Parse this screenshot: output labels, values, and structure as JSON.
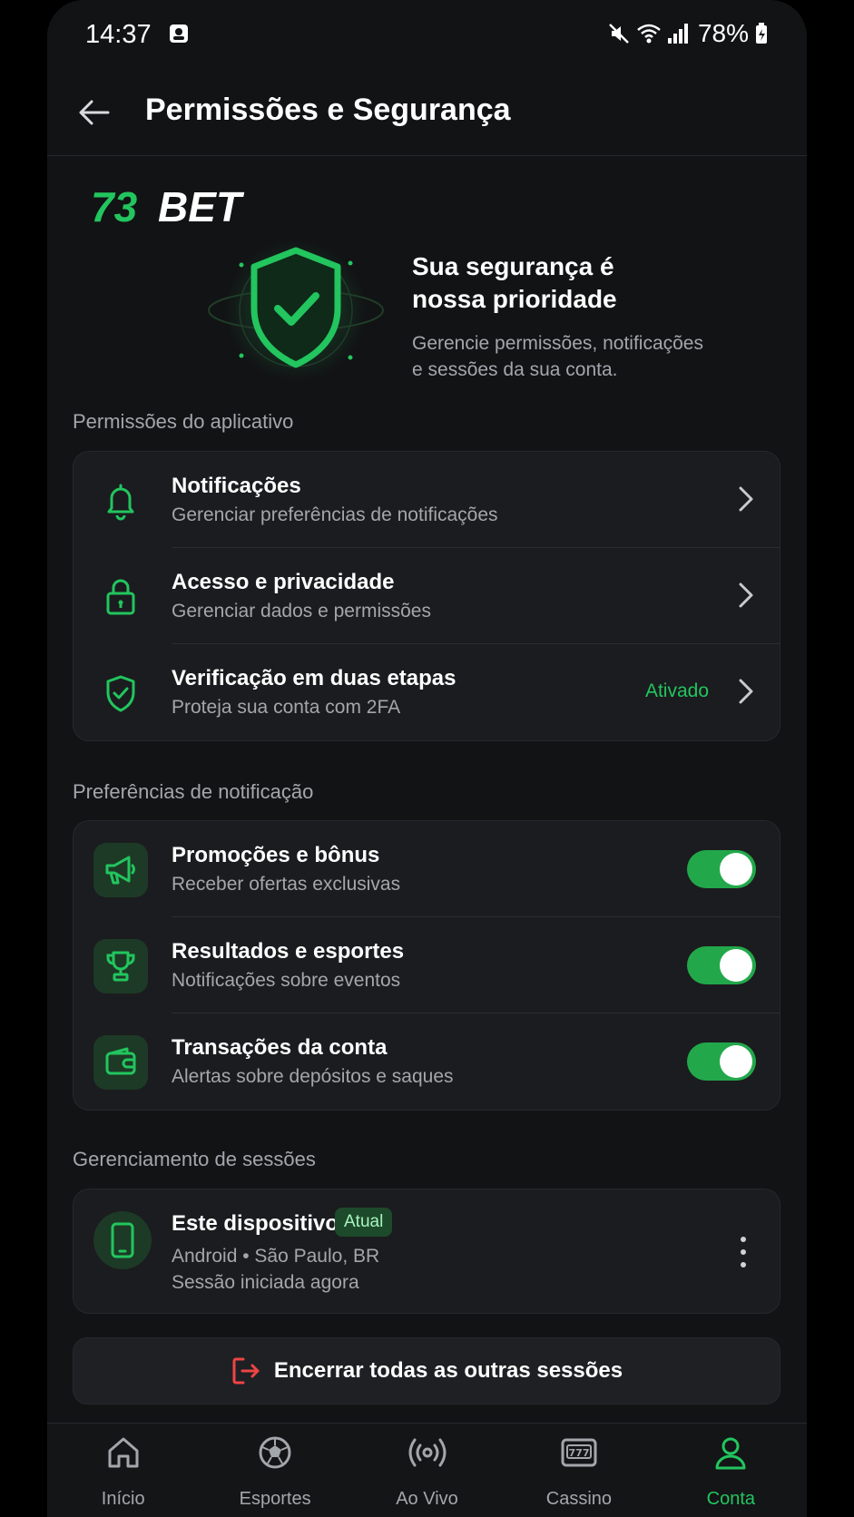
{
  "status_bar": {
    "time": "14:37",
    "battery": "78%"
  },
  "app_bar": {
    "title": "Permissões e Segurança"
  },
  "brand": {
    "logo_number": "73",
    "logo_word": "BET",
    "accent": "#22c55e"
  },
  "hero": {
    "title_line1": "Sua segurança é",
    "title_line2": "nossa prioridade",
    "subtitle_line1": "Gerencie permissões, notificações",
    "subtitle_line2": "e sessões da sua conta."
  },
  "app_permissions": {
    "section_title": "Permissões do aplicativo",
    "items": [
      {
        "icon": "bell-icon",
        "title": "Notificações",
        "subtitle": "Gerenciar preferências de notificações",
        "status": ""
      },
      {
        "icon": "lock-icon",
        "title": "Acesso e privacidade",
        "subtitle": "Gerenciar dados e permissões",
        "status": ""
      },
      {
        "icon": "shield-check-icon",
        "title": "Verificação em duas etapas",
        "subtitle": "Proteja sua conta com 2FA",
        "status": "Ativado"
      }
    ]
  },
  "notification_prefs": {
    "section_title": "Preferências de notificação",
    "items": [
      {
        "icon": "megaphone-icon",
        "title": "Promoções e bônus",
        "subtitle": "Receber ofertas exclusivas",
        "enabled": true
      },
      {
        "icon": "trophy-icon",
        "title": "Resultados e esportes",
        "subtitle": "Notificações sobre eventos",
        "enabled": true
      },
      {
        "icon": "wallet-icon",
        "title": "Transações da conta",
        "subtitle": "Alertas sobre depósitos e saques",
        "enabled": true
      }
    ]
  },
  "sessions": {
    "section_title": "Gerenciamento de sessões",
    "current": {
      "icon": "smartphone-icon",
      "title": "Este dispositivo",
      "badge": "Atual",
      "line1": "Android • São Paulo, BR",
      "line2": "Sessão iniciada agora"
    },
    "end_all_label": "Encerrar todas as outras sessões"
  },
  "bottom_nav": {
    "items": [
      {
        "icon": "home-icon",
        "label": "Início",
        "active": false
      },
      {
        "icon": "soccer-ball-icon",
        "label": "Esportes",
        "active": false
      },
      {
        "icon": "live-broadcast-icon",
        "label": "Ao Vivo",
        "active": false
      },
      {
        "icon": "slot-machine-icon",
        "label": "Cassino",
        "active": false
      },
      {
        "icon": "user-icon",
        "label": "Conta",
        "active": true
      }
    ]
  },
  "colors": {
    "accent": "#22c55e",
    "background": "#121315",
    "card": "#1b1c1f",
    "danger": "#ef4444"
  }
}
